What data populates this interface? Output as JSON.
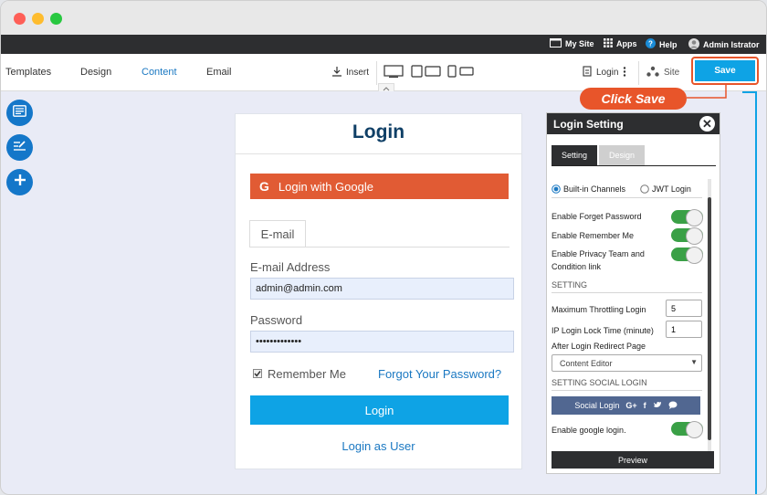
{
  "topbar": {
    "my_site": "My Site",
    "apps": "Apps",
    "help": "Help",
    "user": "Admin Istrator"
  },
  "toolbar": {
    "tabs": [
      "Templates",
      "Design",
      "Content",
      "Email"
    ],
    "active_tab": "Content",
    "insert": "Insert",
    "page_select": "Login",
    "site": "Site",
    "save": "Save"
  },
  "callout": "Click Save",
  "login_panel": {
    "title": "Login",
    "google_button": "Login with Google",
    "email_tab": "E-mail",
    "email_label": "E-mail Address",
    "email_value": "admin@admin.com",
    "password_label": "Password",
    "password_value": "•••••••••••••",
    "remember_me": "Remember Me",
    "forgot_password": "Forgot Your Password?",
    "login_button": "Login",
    "login_as_user": "Login as User"
  },
  "settings": {
    "title": "Login Setting",
    "tabs": [
      "Setting",
      "Design"
    ],
    "active_tab": "Setting",
    "channels": [
      "Built-in Channels",
      "JWT Login"
    ],
    "selected_channel": "Built-in Channels",
    "toggles": [
      {
        "label": "Enable Forget Password",
        "on": true
      },
      {
        "label": "Enable Remember Me",
        "on": true
      },
      {
        "label": "Enable Privacy Team and Condition link",
        "on": true
      }
    ],
    "section_setting": "SETTING",
    "max_throttling_label": "Maximum Throttling Login",
    "max_throttling_value": "5",
    "ip_lock_label": "IP Login Lock Time (minute)",
    "ip_lock_value": "1",
    "redirect_label": "After Login Redirect Page",
    "redirect_value": "Content Editor",
    "section_social": "SETTING SOCIAL LOGIN",
    "social_login": "Social Login",
    "google_login_label": "Enable google login.",
    "google_login_on": true,
    "preview": "Preview"
  },
  "colors": {
    "accent": "#0ea3e5",
    "google": "#e15b34",
    "callout": "#e8552a",
    "toggle_on": "#3aa046",
    "dark": "#2d2e30"
  }
}
